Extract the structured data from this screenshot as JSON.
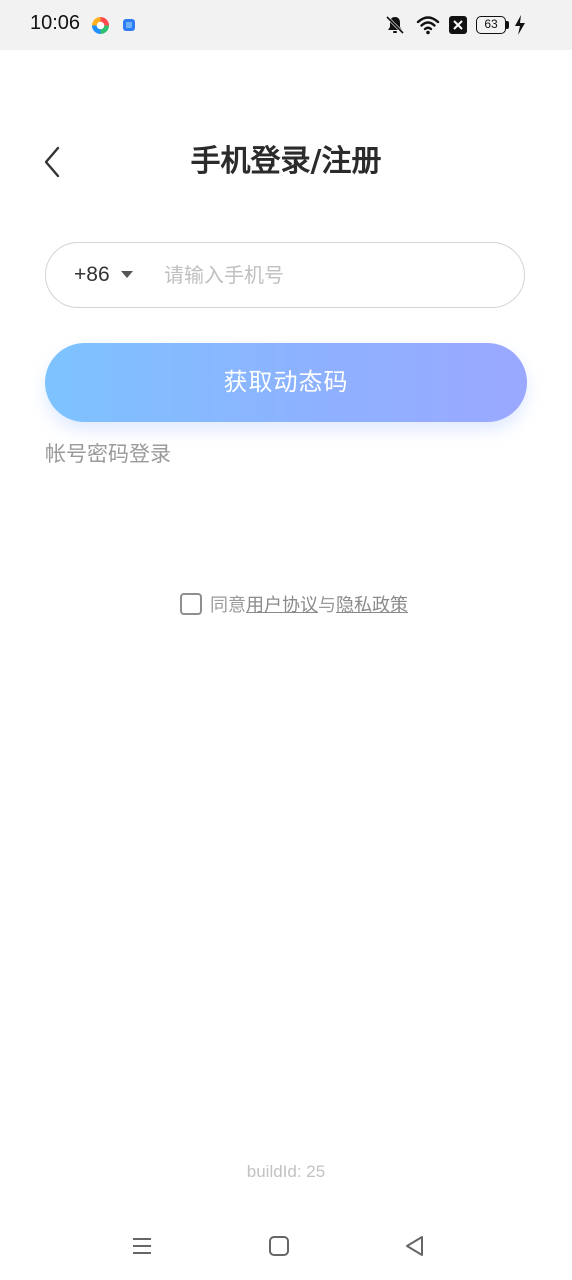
{
  "status_bar": {
    "time": "10:06",
    "battery_level": "63"
  },
  "header": {
    "title": "手机登录/注册"
  },
  "phone_form": {
    "country_code": "+86",
    "phone_placeholder": "请输入手机号",
    "phone_value": ""
  },
  "actions": {
    "get_code_label": "获取动态码",
    "password_login_label": "帐号密码登录"
  },
  "agreement": {
    "prefix": "同意",
    "user_agreement_link": "用户协议",
    "connector": "与",
    "privacy_policy_link": "隐私政策",
    "checked": false
  },
  "footer": {
    "build_id": "buildId: 25"
  },
  "colors": {
    "button_gradient_start": "#7dc3ff",
    "button_gradient_end": "#9aa8ff",
    "muted_text": "#9a9a9a",
    "status_bar_bg": "#f2f2f2"
  },
  "icons": {
    "back": "chevron-left-icon",
    "dropdown": "caret-down-icon",
    "nav_menu": "menu-icon",
    "nav_home": "home-square-icon",
    "nav_back": "back-triangle-icon"
  }
}
